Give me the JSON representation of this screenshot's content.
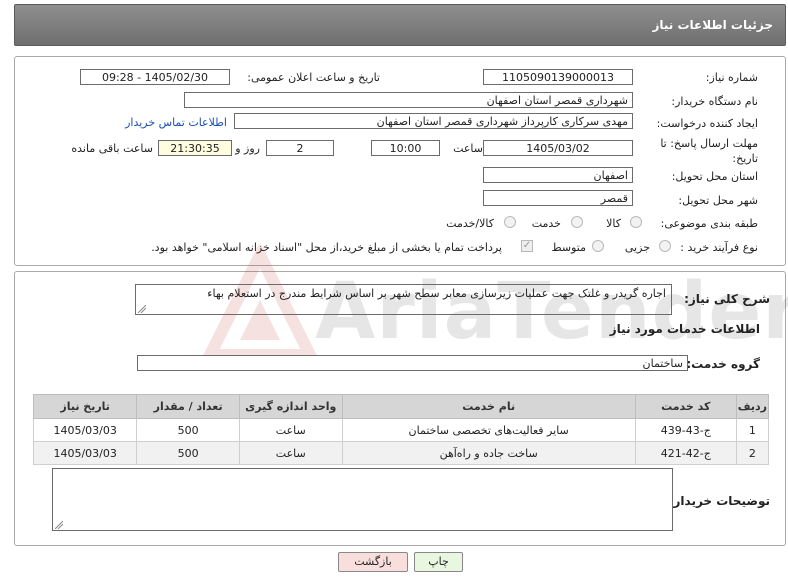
{
  "header": {
    "title": "جزئیات اطلاعات نیاز"
  },
  "form": {
    "need_number_label": "شماره نیاز:",
    "need_number": "1105090139000013",
    "announce_label": "تاریخ و ساعت اعلان عمومی:",
    "announce_value": "1405/02/30 - 09:28",
    "buyer_org_label": "نام دستگاه خریدار:",
    "buyer_org": "شهرداری قمصر استان اصفهان",
    "creator_label": "ایجاد کننده درخواست:",
    "creator": "مهدی سرکاری کارپرداز شهرداری قمصر استان اصفهان",
    "contact_link": "اطلاعات تماس خریدار",
    "deadline_label_1": "مهلت ارسال پاسخ: تا",
    "deadline_label_2": "تاریخ:",
    "deadline_date": "1405/03/02",
    "time_label": "ساعت",
    "deadline_time": "10:00",
    "days_value": "2",
    "days_label": "روز و",
    "remaining_time": "21:30:35",
    "remaining_label": "ساعت باقی مانده",
    "province_label": "استان محل تحویل:",
    "province": "اصفهان",
    "city_label": "شهر محل تحویل:",
    "city": "قمصر",
    "category_label": "طبقه بندی موضوعی:",
    "category_options": [
      "کالا",
      "خدمت",
      "کالا/خدمت"
    ],
    "purchase_type_label": "نوع فرآیند خرید :",
    "purchase_options": [
      "جزیی",
      "متوسط"
    ],
    "payment_note": "پرداخت تمام یا بخشی از مبلغ خرید،از محل \"اسناد خزانه اسلامی\" خواهد بود."
  },
  "description": {
    "label": "شرح کلی نیاز:",
    "text": "اجاره گریدر و غلتک جهت عملیات زیرسازی معابر سطح شهر بر اساس شرایط مندرج در استعلام بهاء"
  },
  "services": {
    "section_title": "اطلاعات خدمات مورد نیاز",
    "group_label": "گروه خدمت:",
    "group_value": "ساختمان",
    "columns": [
      "ردیف",
      "کد خدمت",
      "نام خدمت",
      "واحد اندازه گیری",
      "تعداد / مقدار",
      "تاریخ نیاز"
    ],
    "rows": [
      {
        "index": "1",
        "code": "ج-43-439",
        "name": "سایر فعالیت‌های تخصصی ساختمان",
        "unit": "ساعت",
        "qty": "500",
        "date": "1405/03/03"
      },
      {
        "index": "2",
        "code": "ج-42-421",
        "name": "ساخت جاده و راه‌آهن",
        "unit": "ساعت",
        "qty": "500",
        "date": "1405/03/03"
      }
    ]
  },
  "buyer_notes": {
    "label": "توضیحات خریدار:",
    "text": ""
  },
  "buttons": {
    "print": "چاپ",
    "back": "بازگشت"
  },
  "watermark": {
    "text": "AriaTender.neT"
  },
  "colors": {
    "header_bg": "#7d7d7d",
    "link": "#1a4fb3",
    "back_button_bg": "#f9dede",
    "print_button_bg": "#e9f7e1"
  }
}
